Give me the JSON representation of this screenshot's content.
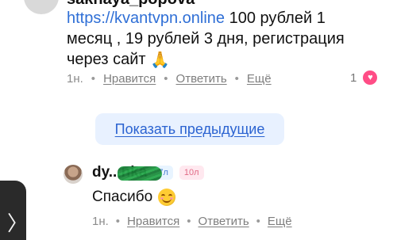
{
  "top_comment": {
    "username": "sakhaya_popova",
    "link_text": "https://kvantvpn.online",
    "text_part_1": " 100 рублей 1 месяц , 19 рублей 3 дня, регистрация через сайт ",
    "emoji": "🙏",
    "meta": {
      "time": "1н.",
      "like_label": "Нравится",
      "reply_label": "Ответить",
      "more_label": "Ещё",
      "separator": "•"
    },
    "likes_count": "1"
  },
  "show_previous": {
    "label": "Показать предыдущие"
  },
  "bottom_comment": {
    "username": "dy...nka",
    "badge_blue": "7л",
    "badge_pink": "10л",
    "text": "Спасибо",
    "meta": {
      "time": "1н.",
      "like_label": "Нравится",
      "reply_label": "Ответить",
      "more_label": "Ещё",
      "separator": "•"
    }
  },
  "colors": {
    "link": "#2f6fd6",
    "button_bg": "#e8f1ff",
    "button_text": "#2b63d1",
    "like_heart": "#ff4d86",
    "badge_blue_bg": "#e8f4ff",
    "badge_pink_bg": "#ffe8ef"
  },
  "icons": {
    "avatar_top": "avatar-placeholder",
    "like_heart": "heart-icon",
    "smile": "smiling-face-icon",
    "left_arrow": "chevron-right-icon"
  }
}
